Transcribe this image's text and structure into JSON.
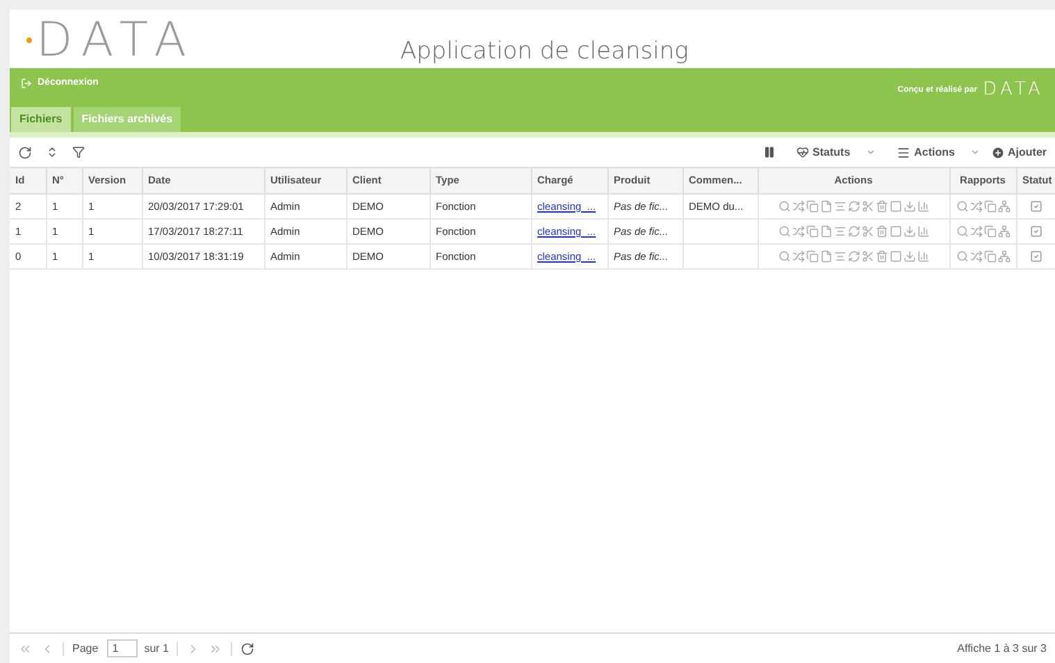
{
  "header": {
    "logo": "DATA",
    "title": "Application de cleansing"
  },
  "banner": {
    "logout": "Déconnexion",
    "credit": "Conçu et réalisé par",
    "credit_logo": "DATA"
  },
  "tabs": [
    {
      "label": "Fichiers",
      "selected": true
    },
    {
      "label": "Fichiers archivés",
      "selected": false
    }
  ],
  "toolbar": {
    "statuts": "Statuts",
    "actions": "Actions",
    "add": "Ajouter"
  },
  "table": {
    "columns": [
      "Id",
      "N°",
      "Version",
      "Date",
      "Utilisateur",
      "Client",
      "Type",
      "Chargé",
      "Produit",
      "Commen...",
      "Actions",
      "Rapports",
      "Statut"
    ],
    "rows": [
      {
        "id": "2",
        "num": "1",
        "version": "1",
        "date": "20/03/2017 17:29:01",
        "user": "Admin",
        "client": "DEMO",
        "type": "Fonction",
        "file": "cleansing_...",
        "product": "Pas de fic...",
        "comment": "DEMO du...",
        "checked": true
      },
      {
        "id": "1",
        "num": "1",
        "version": "1",
        "date": "17/03/2017 18:27:11",
        "user": "Admin",
        "client": "DEMO",
        "type": "Fonction",
        "file": "cleansing_...",
        "product": "Pas de fic...",
        "checked": true
      },
      {
        "id": "0",
        "num": "1",
        "version": "1",
        "date": "10/03/2017 18:31:19",
        "user": "Admin",
        "client": "DEMO",
        "type": "Fonction",
        "file": "cleansing_...",
        "product": "Pas de fic...",
        "checked": true
      }
    ]
  },
  "pager": {
    "page_label": "Page",
    "page": "1",
    "of": "sur 1",
    "summary": "Affiche 1 à 3 sur 3"
  }
}
